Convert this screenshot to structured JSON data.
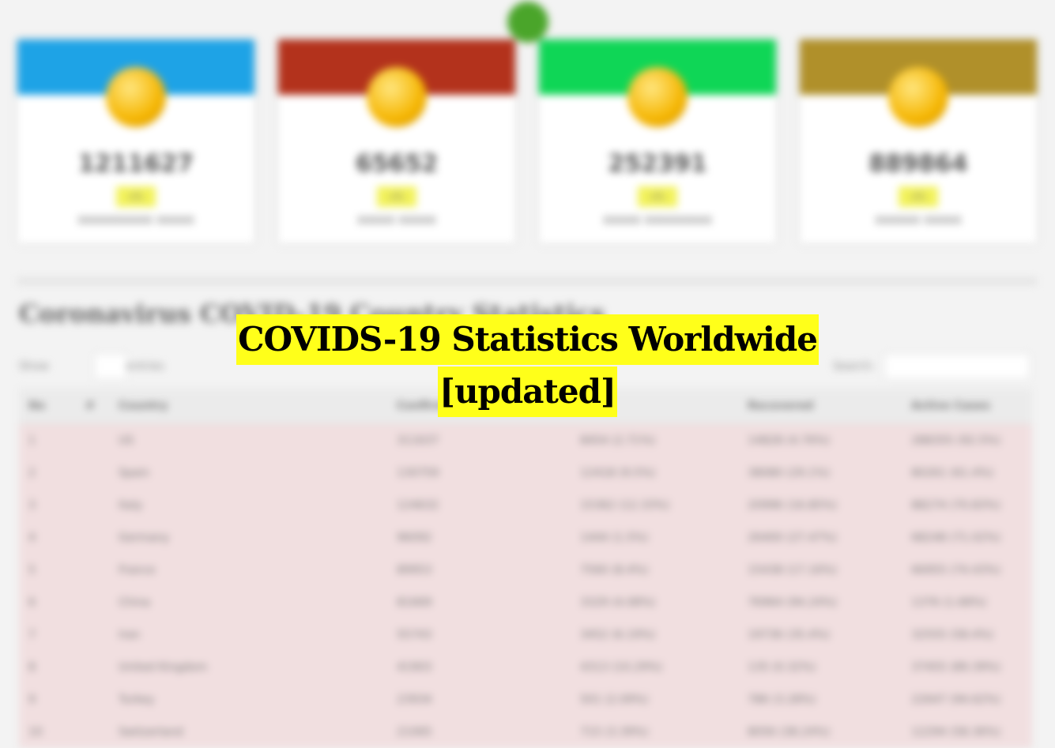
{
  "headline": {
    "line1": "COVIDS-19 Statistics Worldwide",
    "line2": "[updated]"
  },
  "colors": {
    "overlay_bg": "#ffff1a",
    "card_blue": "#1ea3e6",
    "card_red": "#b3321c",
    "card_green": "#0fd656",
    "card_gold": "#b0902a",
    "row_bg": "#f1dfe0",
    "pill": "#f1f25c"
  },
  "cards": [
    {
      "value": "1211627",
      "pill": "x%",
      "caption": "xxxxxxxxxx xxxxx",
      "icon": "emoji-icon"
    },
    {
      "value": "65652",
      "pill": "x%",
      "caption": "xxxxx xxxxx",
      "icon": "emoji-icon"
    },
    {
      "value": "252391",
      "pill": "x%",
      "caption": "xxxxx xxxxxxxxx",
      "icon": "emoji-icon"
    },
    {
      "value": "889864",
      "pill": "x%",
      "caption": "xxxxxx xxxxx",
      "icon": "emoji-icon"
    }
  ],
  "section_title": "Coronavirus COVID-19 Country Statistics",
  "controls": {
    "show_label": "Show",
    "select_value": "10",
    "entries_label": "entries",
    "search_label": "Search:"
  },
  "table": {
    "headers": [
      "No",
      "#",
      "Country",
      "Confirmed",
      "",
      "Recovered",
      "Active Cases"
    ],
    "rows": [
      [
        "1",
        "",
        "US",
        "311637",
        "8454 (2.71%)",
        "14828 (4.76%)",
        "288355 (92.5%)"
      ],
      [
        "2",
        "",
        "Spain",
        "130759",
        "12418 (9.5%)",
        "38080 (29.1%)",
        "80261 (61.4%)"
      ],
      [
        "3",
        "",
        "Italy",
        "124632",
        "15362 (12.33%)",
        "20996 (16.85%)",
        "88274 (70.83%)"
      ],
      [
        "4",
        "",
        "Germany",
        "96092",
        "1444 (1.5%)",
        "26400 (27.47%)",
        "68248 (71.02%)"
      ],
      [
        "5",
        "",
        "France",
        "89953",
        "7560 (8.4%)",
        "15438 (17.16%)",
        "66955 (74.43%)"
      ],
      [
        "6",
        "",
        "China",
        "81669",
        "3329 (4.08%)",
        "76964 (94.24%)",
        "1376 (1.68%)"
      ],
      [
        "7",
        "",
        "Iran",
        "55743",
        "3452 (6.19%)",
        "19736 (35.4%)",
        "32555 (58.4%)"
      ],
      [
        "8",
        "",
        "United Kingdom",
        "41903",
        "4313 (10.29%)",
        "135 (0.32%)",
        "37455 (89.39%)"
      ],
      [
        "9",
        "",
        "Turkey",
        "23934",
        "501 (2.09%)",
        "786 (3.28%)",
        "22647 (94.62%)"
      ],
      [
        "10",
        "",
        "Switzerland",
        "21065",
        "715 (3.39%)",
        "8056 (38.24%)",
        "12294 (58.36%)"
      ]
    ]
  }
}
